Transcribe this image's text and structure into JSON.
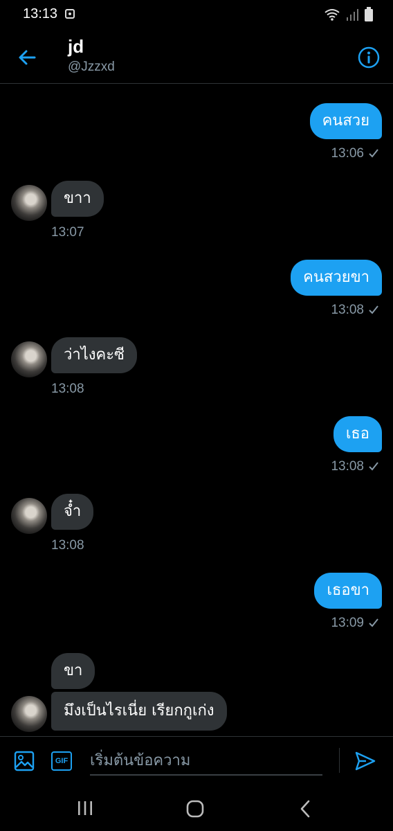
{
  "status": {
    "time": "13:13"
  },
  "header": {
    "name": "jd",
    "handle": "@Jzzxd"
  },
  "messages": [
    {
      "dir": "out",
      "text": "คนสวย",
      "time": "13:06"
    },
    {
      "dir": "in",
      "text": "ขาา",
      "time": "13:07"
    },
    {
      "dir": "out",
      "text": "คนสวยขา",
      "time": "13:08"
    },
    {
      "dir": "in",
      "text": "ว่าไงคะซี",
      "time": "13:08"
    },
    {
      "dir": "out",
      "text": "เธอ",
      "time": "13:08"
    },
    {
      "dir": "in",
      "text": "จ๋ำ",
      "time": "13:08"
    },
    {
      "dir": "out",
      "text": "เธอขา",
      "time": "13:09"
    },
    {
      "dir": "in",
      "text": "ขา",
      "time": ""
    },
    {
      "dir": "in",
      "text": "มึงเป็นไรเนี่ย เรียกกูเก่ง",
      "time": ""
    }
  ],
  "composer": {
    "placeholder": "เริ่มต้นข้อความ",
    "gif_label": "GIF"
  },
  "colors": {
    "accent": "#1da1f2",
    "incoming_bubble": "#2f3336",
    "muted_text": "#8899a6"
  },
  "icons": [
    "back-arrow-icon",
    "info-icon",
    "image-icon",
    "gif-icon",
    "send-icon",
    "recent-apps-icon",
    "home-icon",
    "back-nav-icon",
    "wifi-icon",
    "signal-icon",
    "battery-icon",
    "check-icon"
  ]
}
